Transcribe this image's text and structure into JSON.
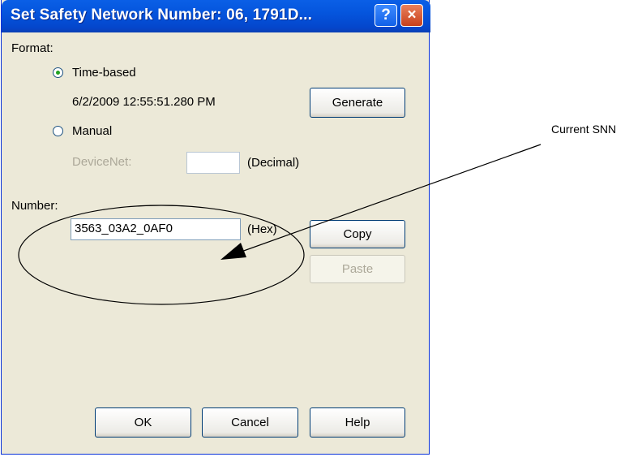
{
  "dialog": {
    "title": "Set Safety Network Number: 06, 1791D...",
    "help_glyph": "?",
    "close_glyph": "×"
  },
  "format": {
    "label": "Format:",
    "time_based": {
      "label": "Time-based",
      "selected": true
    },
    "timestamp": "6/2/2009 12:55:51.280 PM",
    "manual": {
      "label": "Manual",
      "selected": false
    },
    "devicenet": {
      "label": "DeviceNet:",
      "value": "",
      "unit": "(Decimal)"
    }
  },
  "number": {
    "label": "Number:",
    "value": "3563_03A2_0AF0",
    "unit": "(Hex)"
  },
  "buttons": {
    "generate": "Generate",
    "copy": "Copy",
    "paste": "Paste",
    "ok": "OK",
    "cancel": "Cancel",
    "help": "Help"
  },
  "annotation": {
    "callout": "Current SNN"
  },
  "colors": {
    "titlebar": "#0555dd",
    "dialog_bg": "#ece9d8",
    "radio_dot": "#21a121"
  }
}
